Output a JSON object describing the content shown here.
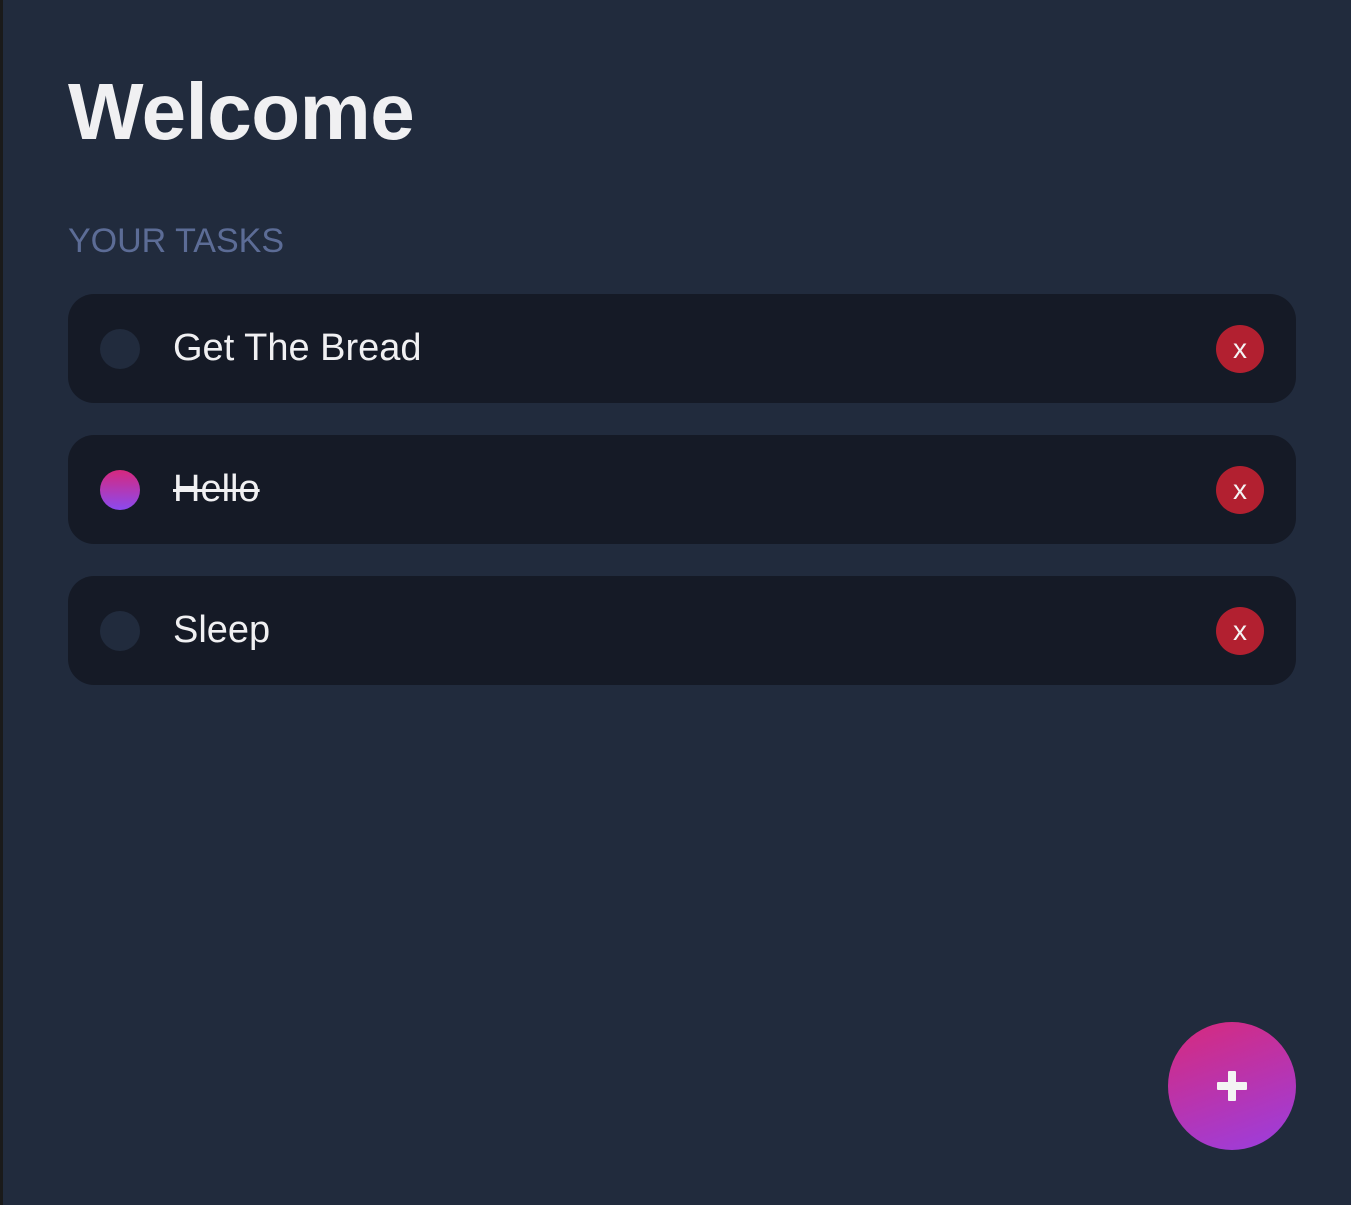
{
  "app": {
    "title": "Welcome",
    "section_label": "YOUR TASKS"
  },
  "tasks": [
    {
      "label": "Get The Bread",
      "completed": false,
      "delete_label": "x"
    },
    {
      "label": "Hello",
      "completed": true,
      "delete_label": "x"
    },
    {
      "label": "Sleep",
      "completed": false,
      "delete_label": "x"
    }
  ],
  "fab": {
    "icon": "plus-icon"
  },
  "colors": {
    "background": "#212b3d",
    "card": "#151a26",
    "delete": "#b22030",
    "accent_start": "#d6287e",
    "accent_end": "#8b4af0",
    "section_label": "#5c6c96"
  }
}
